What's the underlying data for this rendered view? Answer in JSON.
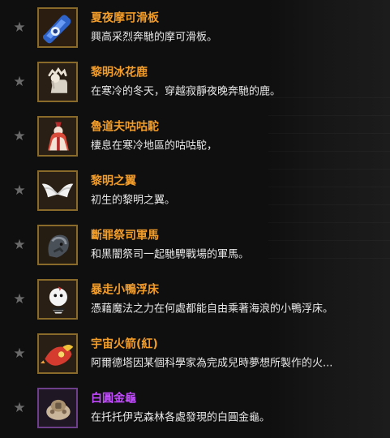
{
  "items": [
    {
      "name": "夏夜摩可滑板",
      "desc": "興高采烈奔馳的摩可滑板。",
      "icon": "skateboard-icon",
      "rarity": "orange"
    },
    {
      "name": "黎明冰花鹿",
      "desc": "在寒冷的冬天，穿越寂靜夜晚奔馳的鹿。",
      "icon": "deer-icon",
      "rarity": "orange"
    },
    {
      "name": "魯道夫咕咕駝",
      "desc": "棲息在寒冷地區的咕咕駝，",
      "icon": "camel-icon",
      "rarity": "orange"
    },
    {
      "name": "黎明之翼",
      "desc": "初生的黎明之翼。",
      "icon": "wings-icon",
      "rarity": "orange"
    },
    {
      "name": "斷罪祭司軍馬",
      "desc": "和黑闇祭司一起馳騁戰場的軍馬。",
      "icon": "warhorse-icon",
      "rarity": "orange"
    },
    {
      "name": "暴走小鴨浮床",
      "desc": "憑藉魔法之力在何處都能自由乘著海浪的小鴨浮床。",
      "icon": "duck-float-icon",
      "rarity": "orange"
    },
    {
      "name": "宇宙火箭(紅)",
      "desc": "阿爾德塔因某個科學家為完成兒時夢想所製作的火...",
      "icon": "rocket-icon",
      "rarity": "orange"
    },
    {
      "name": "白圓金龜",
      "desc": "在托托伊克森林各處發現的白圓金龜。",
      "icon": "turtle-icon",
      "rarity": "purple"
    }
  ],
  "colors": {
    "name_orange": "#f29c2a",
    "name_purple": "#c34cff",
    "desc": "#e7e7e7",
    "star": "#6a6a6a"
  }
}
